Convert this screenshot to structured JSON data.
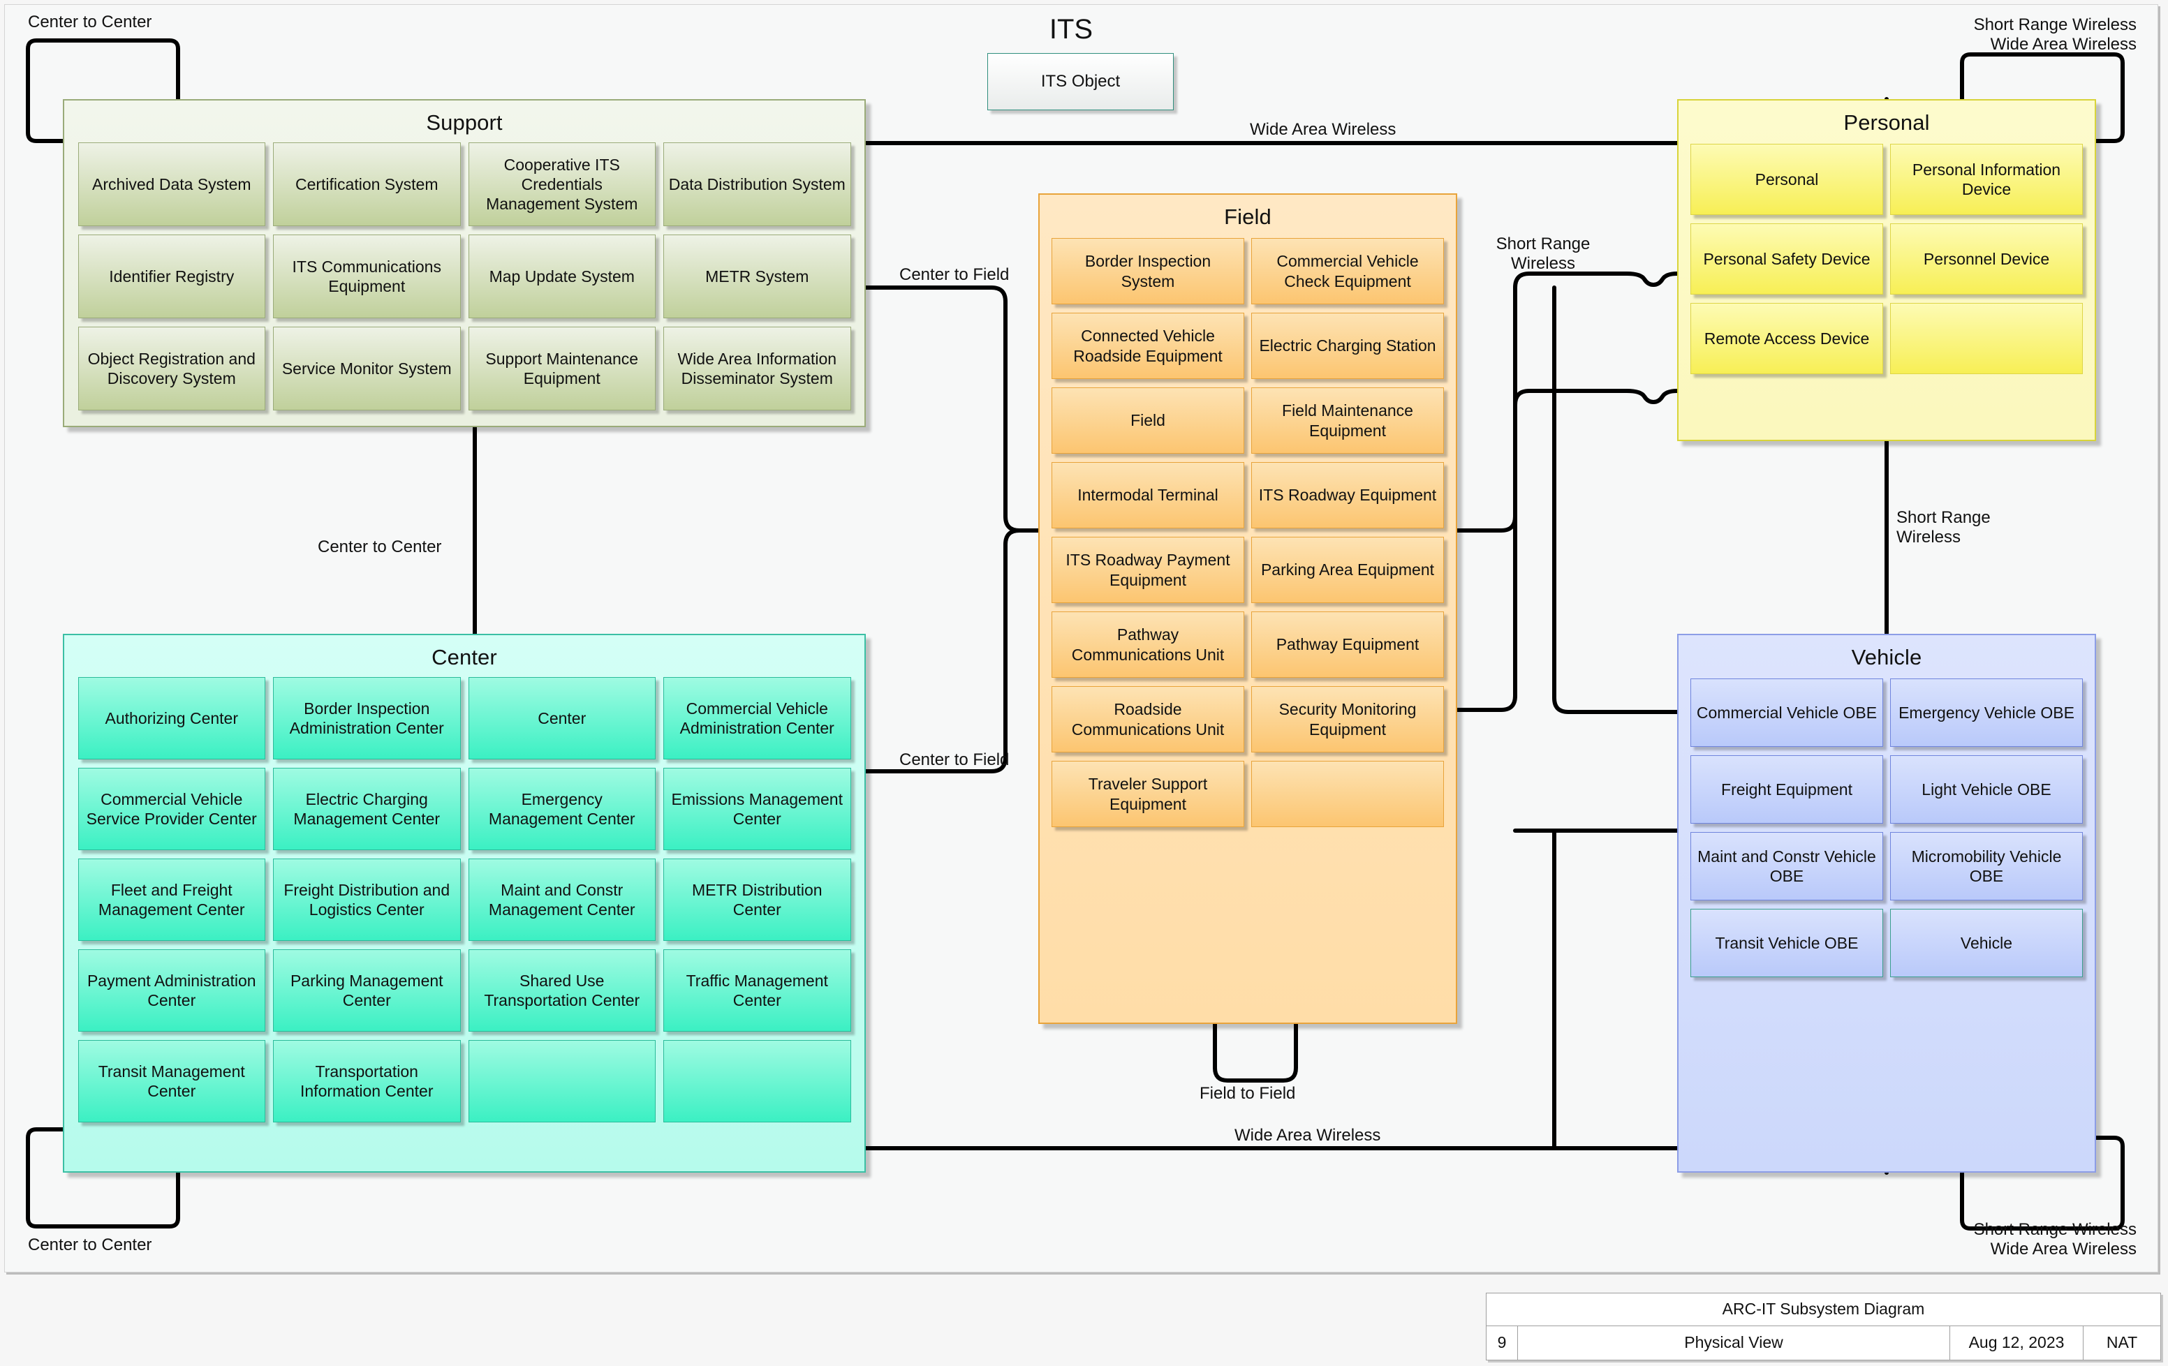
{
  "diagram": {
    "heading": "ITS",
    "its_object_label": "ITS Object"
  },
  "groups": {
    "support": {
      "title": "Support",
      "color": "#c0d09b",
      "items": [
        "Archived Data System",
        "Certification System",
        "Cooperative ITS Credentials Management System",
        "Data Distribution System",
        "Identifier Registry",
        "ITS Communications Equipment",
        "Map Update System",
        "METR System",
        "Object Registration and Discovery System",
        "Service Monitor System",
        "Support Maintenance Equipment",
        "Wide Area Information Disseminator System"
      ]
    },
    "center": {
      "title": "Center",
      "color": "#3bf0c3",
      "items": [
        "Authorizing Center",
        "Border Inspection Administration Center",
        "Center",
        "Commercial Vehicle Administration Center",
        "Commercial Vehicle Service Provider Center",
        "Electric Charging Management Center",
        "Emergency Management Center",
        "Emissions Management Center",
        "Fleet and Freight Management Center",
        "Freight Distribution and Logistics Center",
        "Maint and Constr Management Center",
        "METR Distribution Center",
        "Payment Administration Center",
        "Parking Management Center",
        "Shared Use Transportation Center",
        "Traffic Management Center",
        "Transit Management Center",
        "Transportation Information Center"
      ]
    },
    "field": {
      "title": "Field",
      "color": "#fcc570",
      "items": [
        "Border Inspection System",
        "Commercial Vehicle Check Equipment",
        "Connected Vehicle Roadside Equipment",
        "Electric Charging Station",
        "Field",
        "Field Maintenance Equipment",
        "Intermodal Terminal",
        "ITS Roadway Equipment",
        "ITS Roadway Payment Equipment",
        "Parking Area Equipment",
        "Pathway Communications Unit",
        "Pathway Equipment",
        "Roadside Communications Unit",
        "Security Monitoring Equipment",
        "Traveler Support Equipment"
      ]
    },
    "personal": {
      "title": "Personal",
      "color": "#f7ef55",
      "items": [
        "Personal",
        "Personal Information Device",
        "Personal Safety Device",
        "Personnel Device",
        "Remote Access Device"
      ]
    },
    "vehicle": {
      "title": "Vehicle",
      "color": "#b9c9fa",
      "items": [
        "Commercial Vehicle OBE",
        "Emergency Vehicle OBE",
        "Freight Equipment",
        "Light Vehicle OBE",
        "Maint and Constr Vehicle OBE",
        "Micromobility Vehicle OBE",
        "Transit Vehicle OBE",
        "Vehicle"
      ]
    }
  },
  "connector_labels": {
    "support_loop": "Center to Center",
    "support_to_center": "Center to Center",
    "center_loop": "Center to Center",
    "support_to_field": "Center to Field",
    "center_to_field": "Center to Field",
    "field_loop": "Field to Field",
    "wide_area_wireless_top": "Wide Area Wireless",
    "wide_area_wireless_bottom": "Wide Area Wireless",
    "short_range_wireless_field": "Short Range\nWireless",
    "short_range_wireless_personal_vehicle": "Short Range\nWireless",
    "personal_loop": "Short Range Wireless\nWide Area Wireless",
    "vehicle_loop": "Short Range Wireless\nWide Area Wireless"
  },
  "title_block": {
    "heading": "ARC-IT Subsystem Diagram",
    "number": "9",
    "view": "Physical View",
    "date": "Aug 12, 2023",
    "author": "NAT"
  }
}
